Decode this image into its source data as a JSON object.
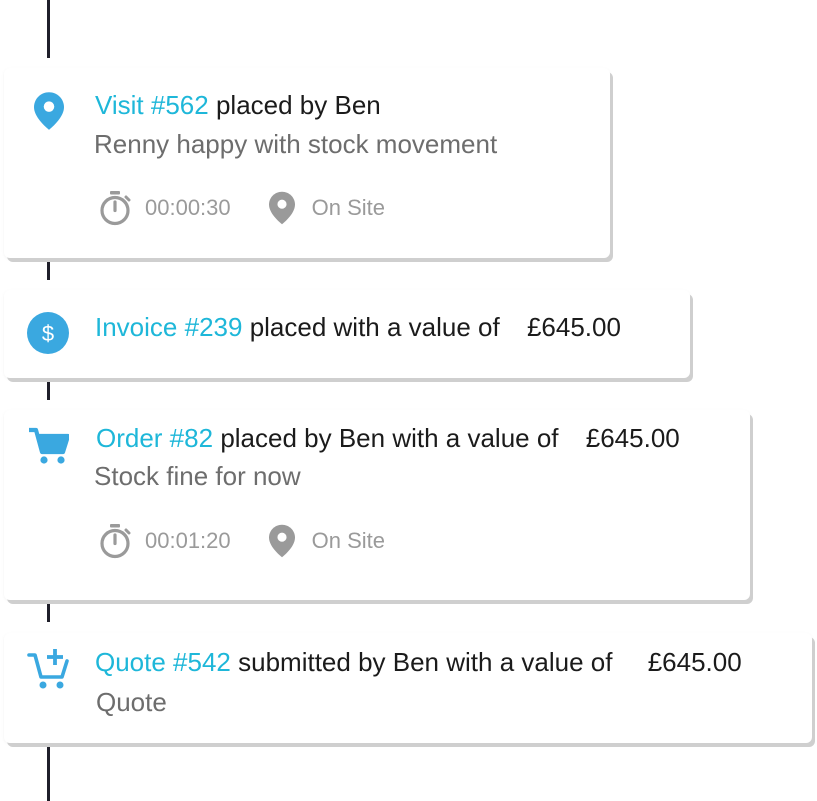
{
  "entries": [
    {
      "type": "visit",
      "link_text": "Visit #562",
      "rest_text": "placed by Ben",
      "note": "Renny happy with stock movement",
      "duration": "00:00:30",
      "location": "On Site"
    },
    {
      "type": "invoice",
      "link_text": "Invoice #239",
      "rest_text": "placed with a value of",
      "amount": "£645.00"
    },
    {
      "type": "order",
      "link_text": "Order #82",
      "rest_text": "placed by Ben with a value of",
      "amount": "£645.00",
      "note": "Stock fine for now",
      "duration": "00:01:20",
      "location": "On Site"
    },
    {
      "type": "quote",
      "link_text": "Quote #542",
      "rest_text": "submitted by Ben with a value of",
      "amount": "£645.00",
      "note": "Quote"
    }
  ],
  "colors": {
    "accent": "#1eb7d9",
    "icon_blue": "#3aa8e0",
    "text_dark": "#1b1b1b",
    "text_muted": "#6d6d6d",
    "meta_gray": "#9a9a9a",
    "timeline": "#1f1f2a",
    "card_shadow": "#cfcfcf"
  },
  "icons": {
    "visit": "map-pin-icon",
    "invoice": "dollar-circle-icon",
    "order": "shopping-cart-icon",
    "quote": "cart-plus-icon",
    "duration": "stopwatch-icon",
    "location": "location-pin-icon"
  }
}
